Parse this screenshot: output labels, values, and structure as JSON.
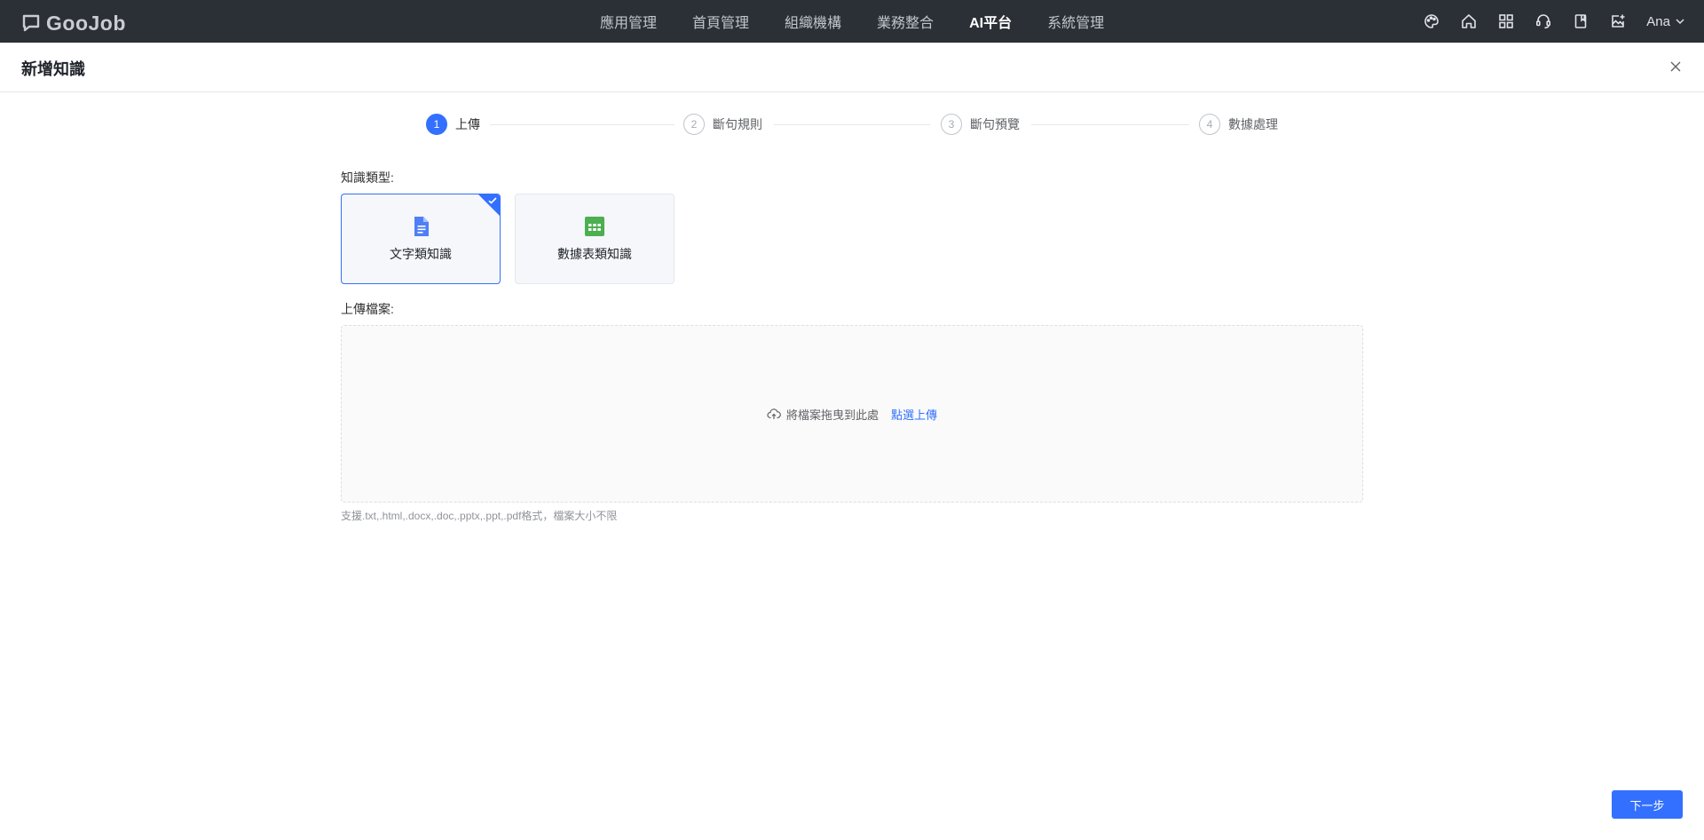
{
  "brand": {
    "logo_text": "GooJob"
  },
  "nav": {
    "items": [
      {
        "label": "應用管理"
      },
      {
        "label": "首頁管理"
      },
      {
        "label": "組織機構"
      },
      {
        "label": "業務整合"
      },
      {
        "label": "AI平台"
      },
      {
        "label": "系統管理"
      }
    ],
    "active_index": 4
  },
  "toolbar": {
    "icons": [
      "palette-icon",
      "home-icon",
      "grid-icon",
      "support-icon",
      "book-icon",
      "image-add-icon"
    ],
    "user_name": "Ana"
  },
  "page": {
    "title": "新增知識"
  },
  "steps": [
    {
      "number": "1",
      "label": "上傳",
      "active": true
    },
    {
      "number": "2",
      "label": "斷句規則",
      "active": false
    },
    {
      "number": "3",
      "label": "斷句預覽",
      "active": false
    },
    {
      "number": "4",
      "label": "數據處理",
      "active": false
    }
  ],
  "form": {
    "type_label": "知識類型:",
    "types": [
      {
        "label": "文字類知識",
        "icon": "document-icon",
        "selected": true
      },
      {
        "label": "數據表類知識",
        "icon": "table-icon",
        "selected": false
      }
    ],
    "upload_label": "上傳檔案:",
    "upload_hint": "將檔案拖曳到此處",
    "upload_link": "點選上傳",
    "upload_tip": "支援.txt,.html,.docx,.doc,.pptx,.ppt,.pdf格式，檔案大小不限"
  },
  "footer": {
    "next_label": "下一步"
  },
  "colors": {
    "accent": "#3370ff",
    "topbar": "#2b2f36",
    "table_icon": "#4caf50"
  }
}
